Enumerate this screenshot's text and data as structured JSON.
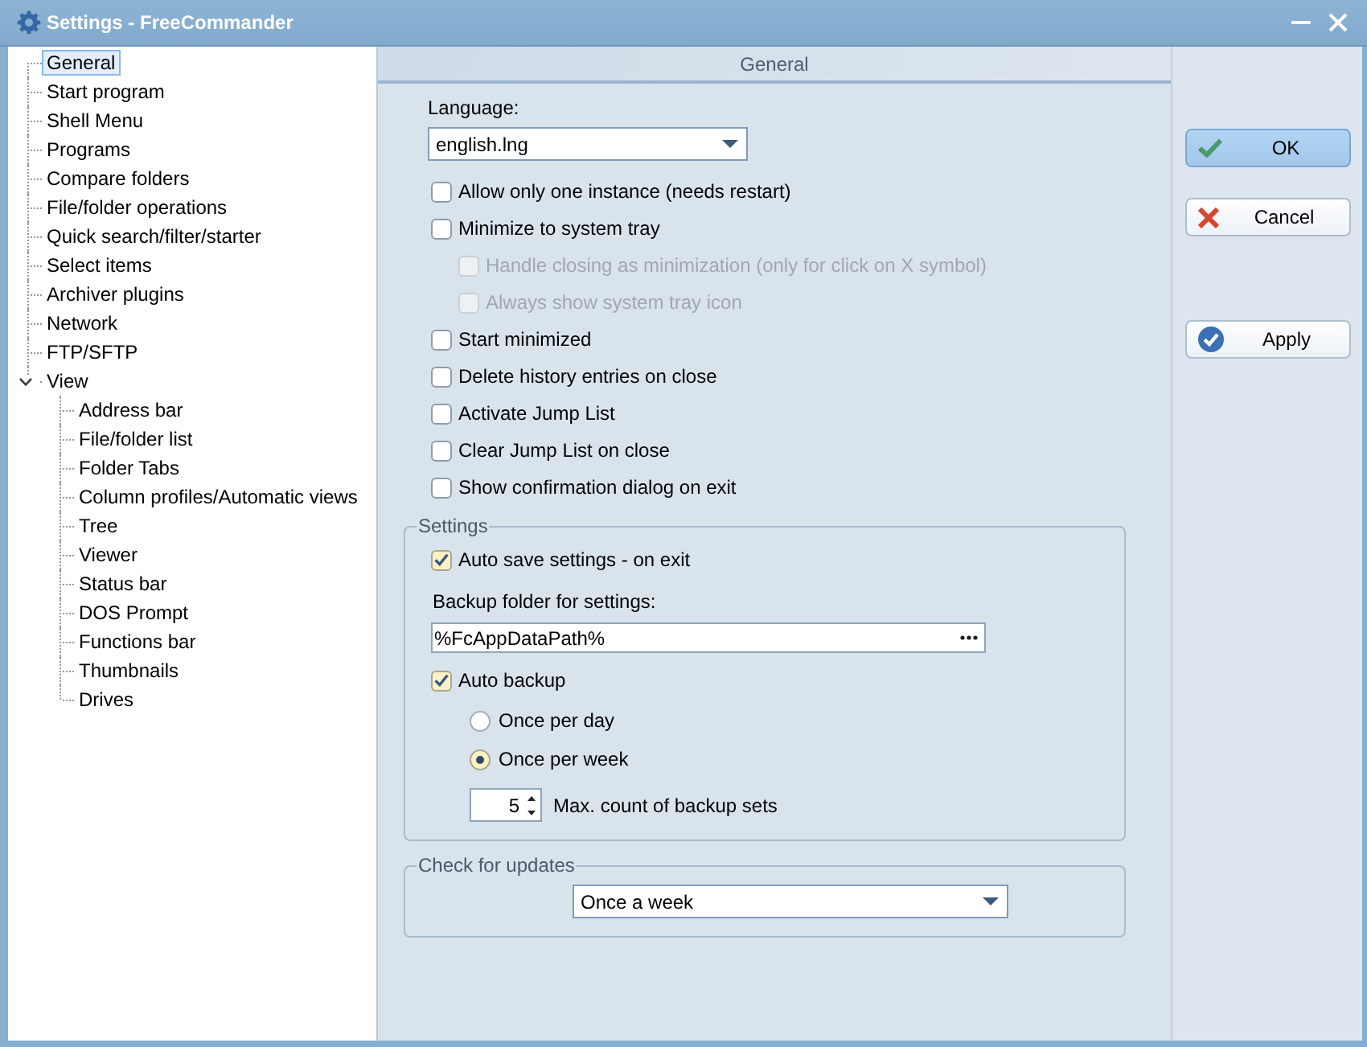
{
  "window": {
    "title": "Settings - FreeCommander"
  },
  "sidebar": {
    "items": [
      {
        "label": "General",
        "selected": true
      },
      {
        "label": "Start program",
        "selected": false
      },
      {
        "label": "Shell Menu",
        "selected": false
      },
      {
        "label": "Programs",
        "selected": false
      },
      {
        "label": "Compare folders",
        "selected": false
      },
      {
        "label": "File/folder operations",
        "selected": false
      },
      {
        "label": "Quick search/filter/starter",
        "selected": false
      },
      {
        "label": "Select items",
        "selected": false
      },
      {
        "label": "Archiver plugins",
        "selected": false
      },
      {
        "label": "Network",
        "selected": false
      },
      {
        "label": "FTP/SFTP",
        "selected": false
      },
      {
        "label": "View",
        "selected": false,
        "expanded": true,
        "children": [
          {
            "label": "Address bar",
            "selected": false
          },
          {
            "label": "File/folder list",
            "selected": false
          },
          {
            "label": "Folder Tabs",
            "selected": false
          },
          {
            "label": "Column profiles/Automatic views",
            "selected": false
          },
          {
            "label": "Tree",
            "selected": false
          },
          {
            "label": "Viewer",
            "selected": false
          },
          {
            "label": "Status bar",
            "selected": false
          },
          {
            "label": "DOS Prompt",
            "selected": false
          },
          {
            "label": "Functions bar",
            "selected": false
          },
          {
            "label": "Thumbnails",
            "selected": false
          },
          {
            "label": "Drives",
            "selected": false
          }
        ]
      }
    ]
  },
  "panel": {
    "title": "General",
    "language": {
      "label": "Language:",
      "value": "english.lng"
    },
    "options": [
      {
        "label": "Allow only one instance (needs restart)",
        "checked": false,
        "disabled": false
      },
      {
        "label": "Minimize to system tray",
        "checked": false,
        "disabled": false,
        "children": [
          {
            "label": "Handle closing as minimization (only for click on X symbol)",
            "checked": false,
            "disabled": true
          },
          {
            "label": "Always show system tray icon",
            "checked": false,
            "disabled": true
          }
        ]
      },
      {
        "label": "Start minimized",
        "checked": false,
        "disabled": false
      },
      {
        "label": "Delete history entries on close",
        "checked": false,
        "disabled": false
      },
      {
        "label": "Activate Jump List",
        "checked": false,
        "disabled": false
      },
      {
        "label": "Clear Jump List on close",
        "checked": false,
        "disabled": false
      },
      {
        "label": "Show confirmation dialog on exit",
        "checked": false,
        "disabled": false
      }
    ],
    "settings_group": {
      "title": "Settings",
      "auto_save": {
        "label": "Auto save settings - on exit",
        "checked": true,
        "disabled": false
      },
      "backup_folder": {
        "label": "Backup folder for settings:",
        "value": "%FcAppDataPath%"
      },
      "auto_backup": {
        "label": "Auto backup",
        "checked": true,
        "disabled": false
      },
      "frequency": [
        {
          "label": "Once per day",
          "selected": false
        },
        {
          "label": "Once per week",
          "selected": true
        }
      ],
      "max_backup_sets": {
        "value": "5",
        "label": "Max. count of backup sets"
      }
    },
    "updates_group": {
      "title": "Check for updates",
      "value": "Once a week"
    }
  },
  "buttons": [
    {
      "kind": "ok",
      "label": "OK",
      "focused": true
    },
    {
      "kind": "cancel",
      "label": "Cancel",
      "focused": false
    },
    {
      "kind": "apply",
      "label": "Apply",
      "focused": false
    }
  ]
}
